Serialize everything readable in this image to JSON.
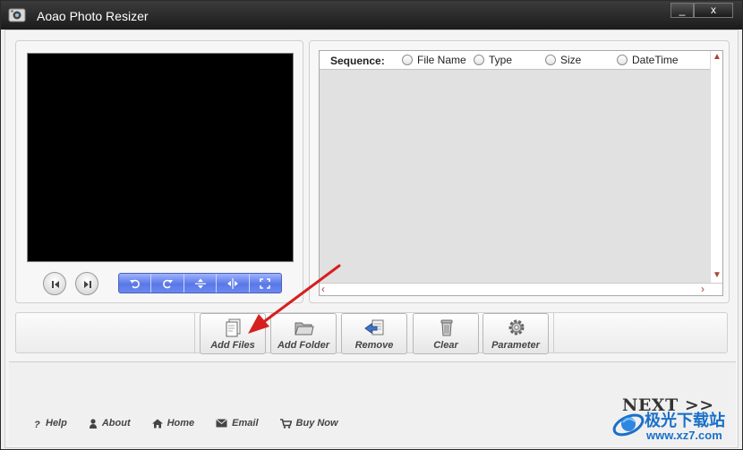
{
  "window": {
    "title": "Aoao Photo Resizer",
    "minimize_glyph": "_",
    "close_glyph": "x"
  },
  "preview": {
    "prev_icon": "skip-previous-icon",
    "next_icon": "skip-next-icon",
    "tools": [
      "rotate-left-icon",
      "rotate-right-icon",
      "flip-vertical-icon",
      "flip-horizontal-icon",
      "fit-screen-icon"
    ]
  },
  "file_list": {
    "sequence_label": "Sequence:",
    "sort_options": [
      "File Name",
      "Type",
      "Size",
      "DateTime"
    ]
  },
  "actions": {
    "add_files": "Add Files",
    "add_folder": "Add Folder",
    "remove": "Remove",
    "clear": "Clear",
    "parameter": "Parameter"
  },
  "footer": {
    "help": "Help",
    "about": "About",
    "home": "Home",
    "email": "Email",
    "buy_now": "Buy Now",
    "next": "NEXT >>"
  },
  "watermark": {
    "name": "极光下载站",
    "url": "www.xz7.com"
  },
  "colors": {
    "titlebar": "#1b1b1b",
    "tool_strip": "#5a78e6",
    "scroll_arrow": "#b0403a",
    "pointer_arrow": "#d62020",
    "watermark": "#1a70c8"
  }
}
